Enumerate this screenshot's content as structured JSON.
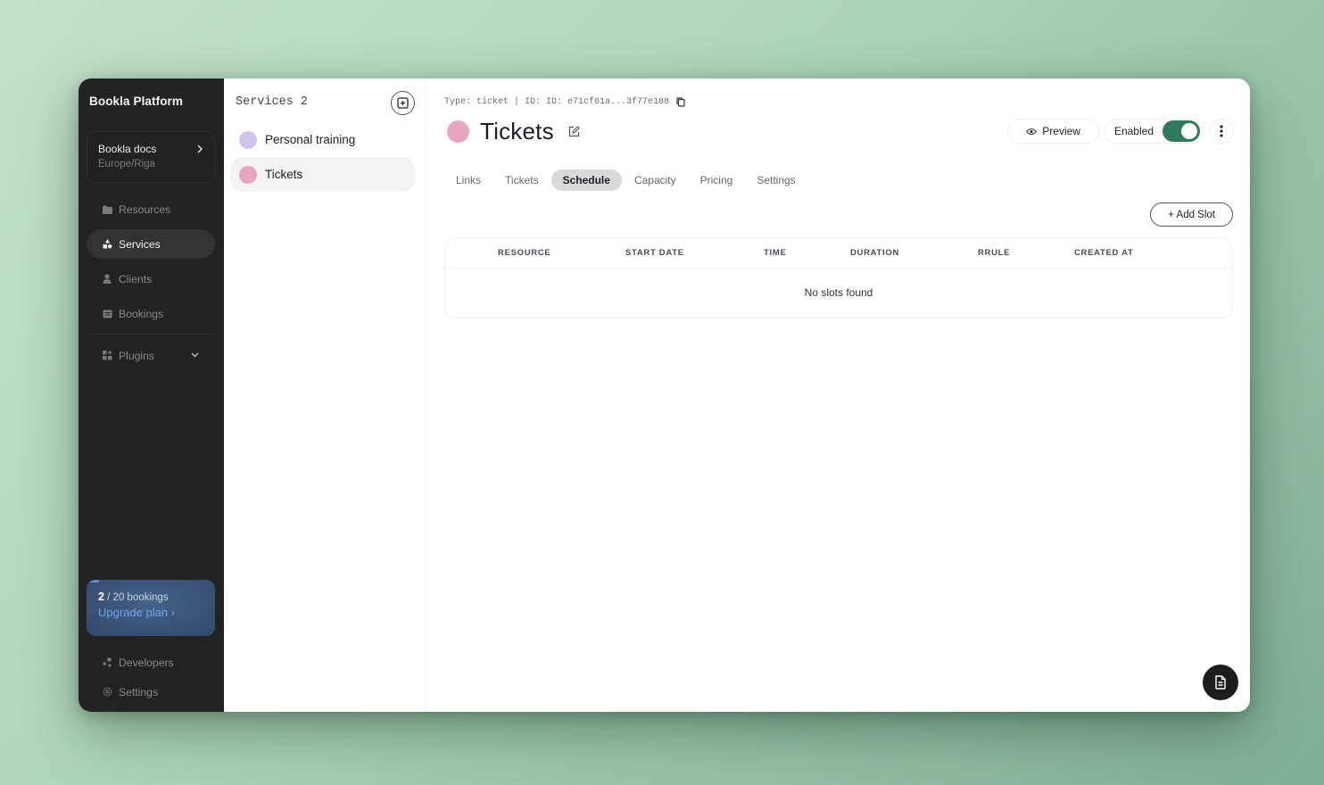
{
  "app": {
    "brand": "Bookla Platform",
    "organization": {
      "name": "Bookla docs",
      "timezone": "Europe/Riga"
    }
  },
  "sidebar": {
    "items": [
      {
        "label": "Resources",
        "icon": "folder-icon",
        "active": false
      },
      {
        "label": "Services",
        "icon": "shapes-icon",
        "active": true
      },
      {
        "label": "Clients",
        "icon": "user-icon",
        "active": false
      },
      {
        "label": "Bookings",
        "icon": "calendar-list-icon",
        "active": false
      },
      {
        "label": "Plugins",
        "icon": "grid-plus-icon",
        "active": false,
        "expandable": true
      }
    ],
    "plan": {
      "used": "2",
      "limit_text": "/ 20 bookings",
      "usage_fraction": 0.1,
      "upgrade_label": "Upgrade plan ›"
    },
    "bottom_items": [
      {
        "label": "Developers",
        "icon": "nodes-icon"
      },
      {
        "label": "Settings",
        "icon": "gear-icon"
      }
    ]
  },
  "services": {
    "header": "Services 2",
    "items": [
      {
        "label": "Personal training",
        "color": "#cfc5ec",
        "active": false
      },
      {
        "label": "Tickets",
        "color": "#e8a5c0",
        "active": true
      }
    ]
  },
  "detail": {
    "meta": "Type: ticket | ID: ID: e71cf61a...3f77e188",
    "title": "Tickets",
    "color": "#e8a5c0",
    "preview_label": "Preview",
    "enabled_label": "Enabled",
    "enabled": true,
    "toggle_color": "#2f7a5c",
    "tabs": [
      {
        "label": "Links",
        "active": false
      },
      {
        "label": "Tickets",
        "active": false
      },
      {
        "label": "Schedule",
        "active": true
      },
      {
        "label": "Capacity",
        "active": false
      },
      {
        "label": "Pricing",
        "active": false
      },
      {
        "label": "Settings",
        "active": false
      }
    ],
    "add_slot_label": "+ Add Slot",
    "table": {
      "columns": [
        "RESOURCE",
        "START DATE",
        "TIME",
        "DURATION",
        "RRULE",
        "CREATED AT"
      ],
      "rows": [],
      "empty_text": "No slots found"
    }
  }
}
